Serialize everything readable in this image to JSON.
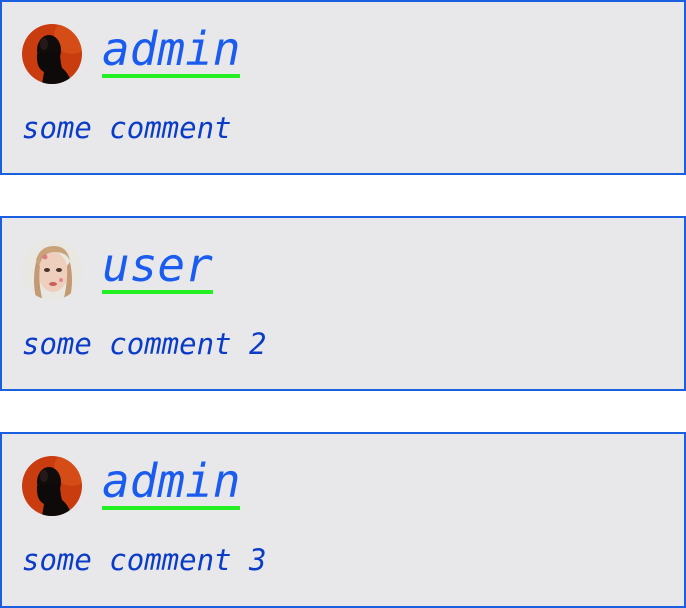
{
  "comments": [
    {
      "author": "admin",
      "avatar": "admin-avatar",
      "text": "some comment"
    },
    {
      "author": "user",
      "avatar": "user-avatar",
      "text": "some comment 2"
    },
    {
      "author": "admin",
      "avatar": "admin-avatar",
      "text": "some comment 3"
    }
  ],
  "colors": {
    "card_border": "#1a5fe0",
    "card_background": "#e8e7ea",
    "username_link": "#1a5cf0",
    "username_underline": "#22f022",
    "comment_text": "#0a3cc7"
  }
}
